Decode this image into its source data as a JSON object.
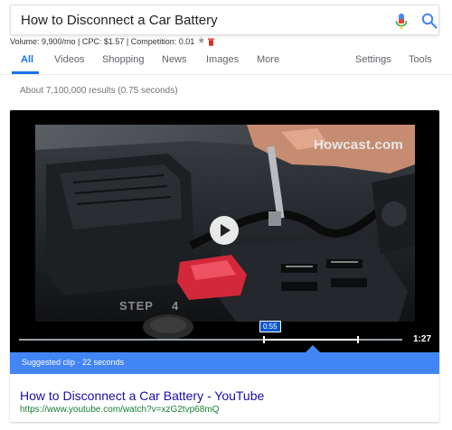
{
  "search": {
    "query": "How to Disconnect a Car Battery"
  },
  "metrics": {
    "text": "Volume: 9,900/mo | CPC: $1.57 | Competition: 0.01",
    "star": "★"
  },
  "tabs": {
    "items": [
      {
        "label": "All",
        "active": true
      },
      {
        "label": "Videos"
      },
      {
        "label": "Shopping"
      },
      {
        "label": "News"
      },
      {
        "label": "Images"
      },
      {
        "label": "More"
      },
      {
        "label": "Settings"
      },
      {
        "label": "Tools"
      }
    ]
  },
  "results": {
    "count_text": "About 7,100,000 results (0.75 seconds)"
  },
  "video": {
    "watermark": "Howcast.com",
    "step_word": "STEP",
    "step_number": "4",
    "clip_start": "0:55",
    "duration": "1:27",
    "suggested_clip": "Suggested clip · 22 seconds"
  },
  "result": {
    "title": "How to Disconnect a Car Battery - YouTube",
    "url": "https://www.youtube.com/watch?v=xzG2tvp68mQ"
  },
  "colors": {
    "accent": "#1a73e8",
    "link": "#1a0dab",
    "url": "#188038",
    "suggested_bar": "#4285f4"
  }
}
